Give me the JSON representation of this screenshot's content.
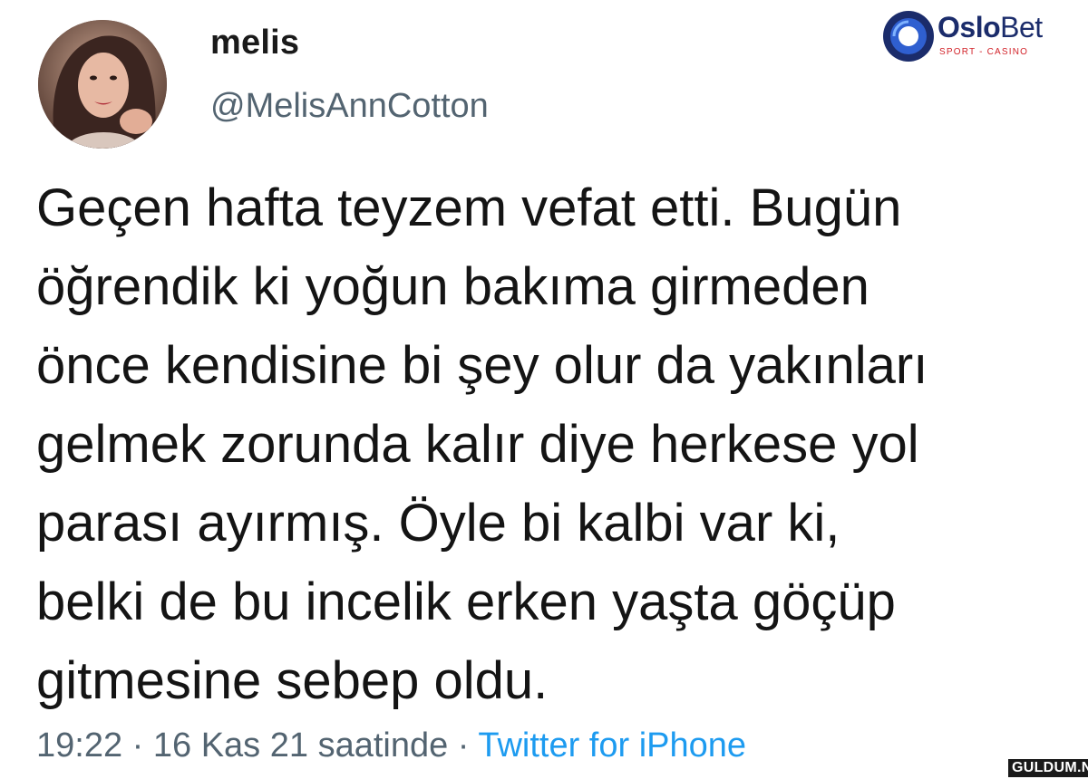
{
  "profile": {
    "display_name": "melis",
    "handle": "@MelisAnnCotton",
    "avatar_icon": "profile-photo"
  },
  "tweet": {
    "lines": [
      "Geçen hafta teyzem vefat etti. Bugün",
      "öğrendik ki yoğun bakıma girmeden",
      "önce kendisine bi şey olur da yakınları",
      "gelmek zorunda kalır diye herkese yol",
      "parası ayırmış. Öyle bi kalbi var ki,",
      "belki de bu incelik erken yaşta göçüp",
      "gitmesine sebep oldu."
    ],
    "time": "19:22",
    "separator": "·",
    "date": "16 Kas 21 saatinde",
    "source": "Twitter for iPhone"
  },
  "brand": {
    "name_part1": "Oslo",
    "name_part2": "Bet",
    "tagline": "SPORT - CASINO",
    "primary_color": "#1b2c6b",
    "accent_color": "#d2232a"
  },
  "watermark": {
    "text": "GULDUM.NET"
  },
  "colors": {
    "text": "#141414",
    "muted": "#536471",
    "link": "#1d9bf0",
    "background": "#ffffff"
  }
}
